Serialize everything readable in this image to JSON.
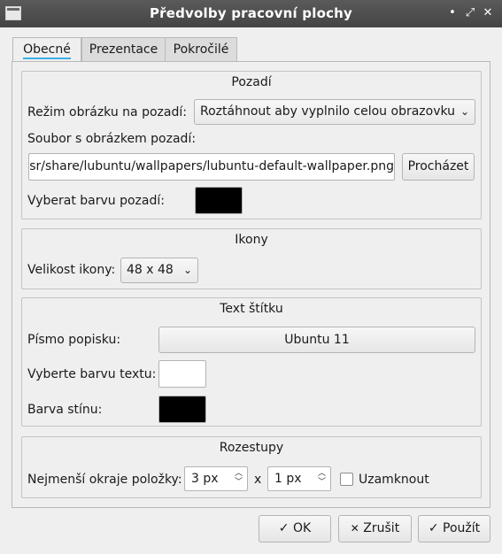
{
  "window": {
    "title": "Předvolby pracovní plochy",
    "controls": {
      "minimize": "•",
      "maximize": "⤢",
      "close": "✕"
    }
  },
  "tabs": [
    "Obecné",
    "Prezentace",
    "Pokročilé"
  ],
  "background": {
    "title": "Pozadí",
    "mode_label": "Režim obrázku na pozadí:",
    "mode_value": "Roztáhnout aby vyplnilo celou obrazovku",
    "file_label": "Soubor s obrázkem pozadí:",
    "file_value": "/usr/share/lubuntu/wallpapers/lubuntu-default-wallpaper.png",
    "browse": "Procházet",
    "color_label": "Vyberat barvu pozadí:",
    "color": "#000000"
  },
  "icons": {
    "title": "Ikony",
    "size_label": "Velikost ikony:",
    "size_value": "48 x 48"
  },
  "label_text": {
    "title": "Text štítku",
    "font_label": "Písmo popisku:",
    "font_value": "Ubuntu 11",
    "text_color_label": "Vyberte barvu textu:",
    "text_color": "#ffffff",
    "shadow_label": "Barva stínu:",
    "shadow_color": "#000000"
  },
  "spacing": {
    "title": "Rozestupy",
    "margin_label": "Nejmenší okraje položky:",
    "x_value": "3 px",
    "times": "x",
    "y_value": "1 px",
    "lock_label": "Uzamknout"
  },
  "buttons": {
    "ok": "OK",
    "ok_icon": "✓",
    "cancel": "Zrušit",
    "cancel_icon": "✕",
    "apply": "Použít",
    "apply_icon": "✓"
  },
  "colors": {
    "accent": "#3daee9",
    "titlebar": "#4a4a4a"
  }
}
